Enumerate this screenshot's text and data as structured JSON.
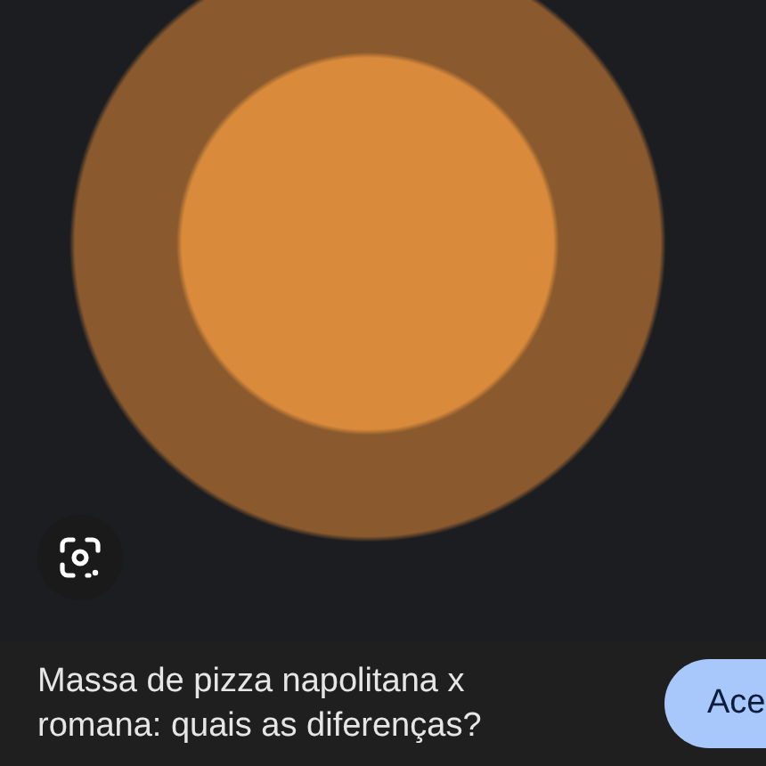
{
  "title": "Massa de pizza napolitana x romana: quais as diferenças?",
  "action_button": {
    "label": "Ace"
  }
}
